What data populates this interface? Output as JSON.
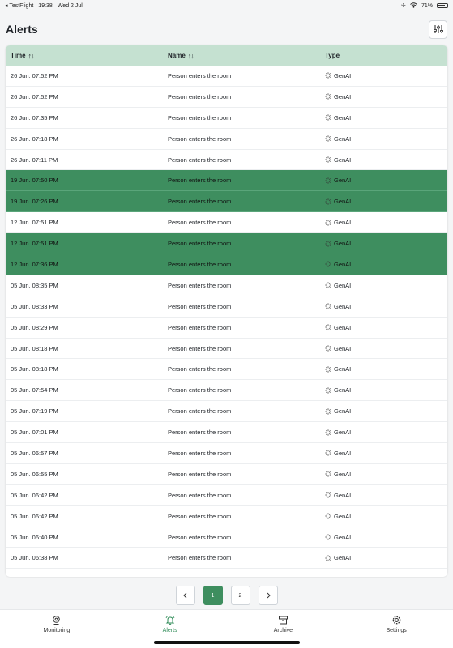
{
  "status_bar": {
    "app_back": "◂ TestFlight",
    "time": "19:38",
    "date": "Wed 2 Jul",
    "battery": "71%"
  },
  "header": {
    "title": "Alerts"
  },
  "table": {
    "columns": {
      "time": "Time",
      "name": "Name",
      "type": "Type"
    },
    "rows": [
      {
        "time": "26 Jun. 07:52 PM",
        "name": "Person enters the room",
        "type": "GenAI",
        "selected": false
      },
      {
        "time": "26 Jun. 07:52 PM",
        "name": "Person enters the room",
        "type": "GenAI",
        "selected": false
      },
      {
        "time": "26 Jun. 07:35 PM",
        "name": "Person enters the room",
        "type": "GenAI",
        "selected": false
      },
      {
        "time": "26 Jun. 07:18 PM",
        "name": "Person enters the room",
        "type": "GenAI",
        "selected": false
      },
      {
        "time": "26 Jun. 07:11 PM",
        "name": "Person enters the room",
        "type": "GenAI",
        "selected": false
      },
      {
        "time": "19 Jun. 07:50 PM",
        "name": "Person enters the room",
        "type": "GenAI",
        "selected": true
      },
      {
        "time": "19 Jun. 07:26 PM",
        "name": "Person enters the room",
        "type": "GenAI",
        "selected": true
      },
      {
        "time": "12 Jun. 07:51 PM",
        "name": "Person enters the room",
        "type": "GenAI",
        "selected": false
      },
      {
        "time": "12 Jun. 07:51 PM",
        "name": "Person enters the room",
        "type": "GenAI",
        "selected": true
      },
      {
        "time": "12 Jun. 07:36 PM",
        "name": "Person enters the room",
        "type": "GenAI",
        "selected": true
      },
      {
        "time": "05 Jun. 08:35 PM",
        "name": "Person enters the room",
        "type": "GenAI",
        "selected": false
      },
      {
        "time": "05 Jun. 08:33 PM",
        "name": "Person enters the room",
        "type": "GenAI",
        "selected": false
      },
      {
        "time": "05 Jun. 08:29 PM",
        "name": "Person enters the room",
        "type": "GenAI",
        "selected": false
      },
      {
        "time": "05 Jun. 08:18 PM",
        "name": "Person enters the room",
        "type": "GenAI",
        "selected": false
      },
      {
        "time": "05 Jun. 08:18 PM",
        "name": "Person enters the room",
        "type": "GenAI",
        "selected": false
      },
      {
        "time": "05 Jun. 07:54 PM",
        "name": "Person enters the room",
        "type": "GenAI",
        "selected": false
      },
      {
        "time": "05 Jun. 07:19 PM",
        "name": "Person enters the room",
        "type": "GenAI",
        "selected": false
      },
      {
        "time": "05 Jun. 07:01 PM",
        "name": "Person enters the room",
        "type": "GenAI",
        "selected": false
      },
      {
        "time": "05 Jun. 06:57 PM",
        "name": "Person enters the room",
        "type": "GenAI",
        "selected": false
      },
      {
        "time": "05 Jun. 06:55 PM",
        "name": "Person enters the room",
        "type": "GenAI",
        "selected": false
      },
      {
        "time": "05 Jun. 06:42 PM",
        "name": "Person enters the room",
        "type": "GenAI",
        "selected": false
      },
      {
        "time": "05 Jun. 06:42 PM",
        "name": "Person enters the room",
        "type": "GenAI",
        "selected": false
      },
      {
        "time": "05 Jun. 06:40 PM",
        "name": "Person enters the room",
        "type": "GenAI",
        "selected": false
      },
      {
        "time": "05 Jun. 06:38 PM",
        "name": "Person enters the room",
        "type": "GenAI",
        "selected": false
      }
    ]
  },
  "pagination": {
    "prev": "‹",
    "pages": [
      "1",
      "2"
    ],
    "current": "1",
    "next": "›"
  },
  "tabbar": {
    "items": [
      {
        "label": "Monitoring",
        "icon": "webcam-icon",
        "active": false
      },
      {
        "label": "Alerts",
        "icon": "bell-icon",
        "active": true
      },
      {
        "label": "Archive",
        "icon": "archive-box-icon",
        "active": false
      },
      {
        "label": "Settings",
        "icon": "gear-icon",
        "active": false
      }
    ]
  },
  "colors": {
    "accent": "#3e8e5f",
    "header_bg": "#c5e1d1",
    "active_tab": "#2e8b57"
  }
}
